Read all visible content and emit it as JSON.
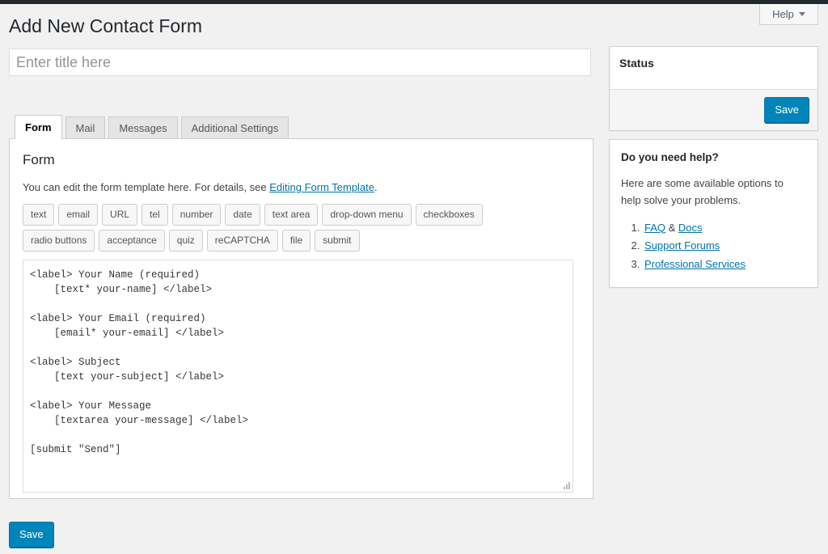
{
  "adminbar": {
    "present": true
  },
  "help_tab": {
    "label": "Help",
    "icon": "chevron-down-icon"
  },
  "header": {
    "title": "Add New Contact Form"
  },
  "title_field": {
    "value": "",
    "placeholder": "Enter title here"
  },
  "tabs": [
    {
      "label": "Form",
      "active": true
    },
    {
      "label": "Mail",
      "active": false
    },
    {
      "label": "Messages",
      "active": false
    },
    {
      "label": "Additional Settings",
      "active": false
    }
  ],
  "form_panel": {
    "heading": "Form",
    "description_before": "You can edit the form template here. For details, see ",
    "description_link": "Editing Form Template",
    "description_after": ".",
    "tag_buttons": [
      "text",
      "email",
      "URL",
      "tel",
      "number",
      "date",
      "text area",
      "drop-down menu",
      "checkboxes",
      "radio buttons",
      "acceptance",
      "quiz",
      "reCAPTCHA",
      "file",
      "submit"
    ],
    "template_code": "<label> Your Name (required)\n    [text* your-name] </label>\n\n<label> Your Email (required)\n    [email* your-email] </label>\n\n<label> Subject\n    [text your-subject] </label>\n\n<label> Your Message\n    [textarea your-message] </label>\n\n[submit \"Send\"]"
  },
  "bottom_save": {
    "label": "Save"
  },
  "status_box": {
    "heading": "Status",
    "save_label": "Save"
  },
  "help_box": {
    "heading": "Do you need help?",
    "paragraph": "Here are some available options to help solve your problems.",
    "items": [
      {
        "parts": [
          "FAQ",
          " & ",
          "Docs"
        ]
      },
      {
        "parts": [
          "Support Forums"
        ]
      },
      {
        "parts": [
          "Professional Services"
        ]
      }
    ],
    "item1_link1": "FAQ",
    "item1_sep": " & ",
    "item1_link2": "Docs",
    "item2_link": "Support Forums",
    "item3_link": "Professional Services"
  },
  "colors": {
    "accent": "#0085ba",
    "link": "#0073aa",
    "adminbar": "#23282d",
    "page_bg": "#f1f1f1"
  }
}
